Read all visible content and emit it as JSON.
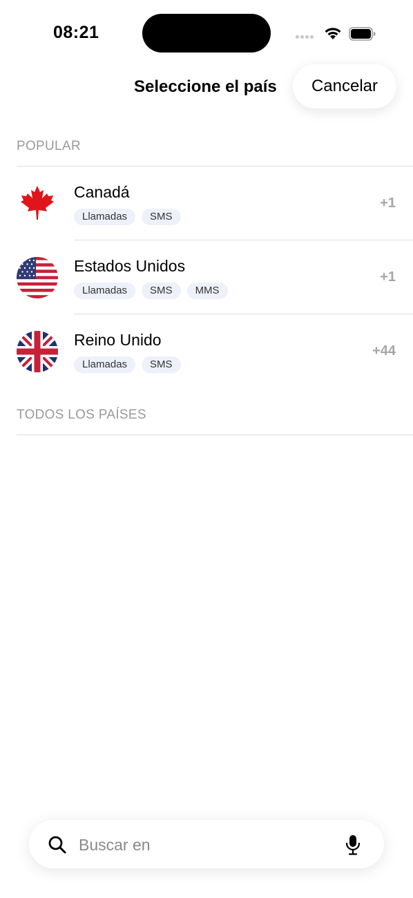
{
  "status_bar": {
    "time": "08:21"
  },
  "header": {
    "title": "Seleccione el país",
    "cancel_label": "Cancelar"
  },
  "sections": {
    "popular_label": "POPULAR",
    "all_label": "TODOS LOS PAÍSES"
  },
  "countries": [
    {
      "name": "Canadá",
      "code": "+1",
      "flag_icon": "canada-flag-icon",
      "tags": [
        "Llamadas",
        "SMS"
      ]
    },
    {
      "name": "Estados Unidos",
      "code": "+1",
      "flag_icon": "usa-flag-icon",
      "tags": [
        "Llamadas",
        "SMS",
        "MMS"
      ]
    },
    {
      "name": "Reino Unido",
      "code": "+44",
      "flag_icon": "uk-flag-icon",
      "tags": [
        "Llamadas",
        "SMS"
      ]
    }
  ],
  "search": {
    "placeholder": "Buscar en",
    "value": ""
  },
  "icons": {
    "search": "search-icon",
    "mic": "microphone-icon",
    "wifi": "wifi-icon",
    "battery": "battery-icon"
  },
  "colors": {
    "tag_background": "#edf1f9",
    "secondary_text": "#9a9a9a",
    "dial_code": "#a6a6a6"
  }
}
